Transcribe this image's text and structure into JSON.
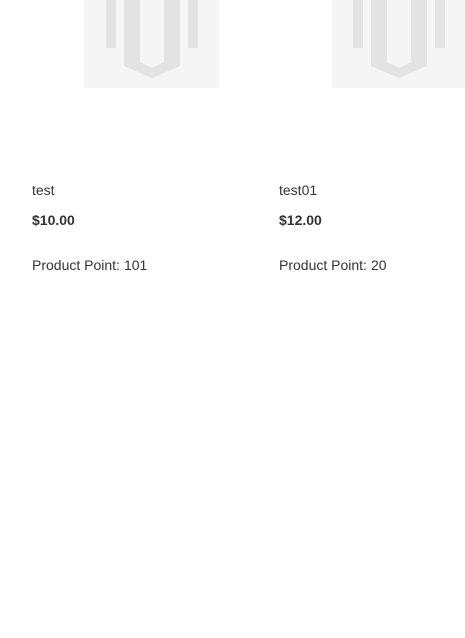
{
  "products": [
    {
      "image_icon": "placeholder-logo-icon",
      "name": "test",
      "price": "$10.00",
      "points_label": "Product Point:",
      "points_value": "101"
    },
    {
      "image_icon": "placeholder-logo-icon",
      "name": "test01",
      "price": "$12.00",
      "points_label": "Product Point:",
      "points_value": "20"
    }
  ],
  "colors": {
    "text": "#333333",
    "image_bg": "#f5f5f5",
    "logo_mark": "#e3e3e3"
  }
}
